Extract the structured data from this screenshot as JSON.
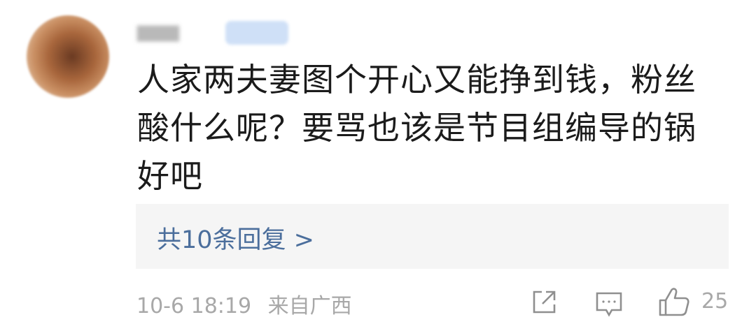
{
  "comment": {
    "lines": [
      "人家两夫妻图个开心又能挣到钱，粉丝",
      "酸什么呢？要骂也该是节目组编导的锅",
      "好吧"
    ]
  },
  "replies": {
    "label": "共10条回复 >"
  },
  "meta": {
    "date": "10-6 18:19",
    "location": "来自广西"
  },
  "actions": {
    "like_count": "25"
  },
  "icons": {
    "share": "share-icon",
    "comment": "comment-icon",
    "like": "thumbs-up-icon"
  },
  "colors": {
    "link": "#4b6e9c",
    "meta": "#a8a8a8",
    "text": "#1b1b1b",
    "reply_bg": "#f5f5f5"
  }
}
